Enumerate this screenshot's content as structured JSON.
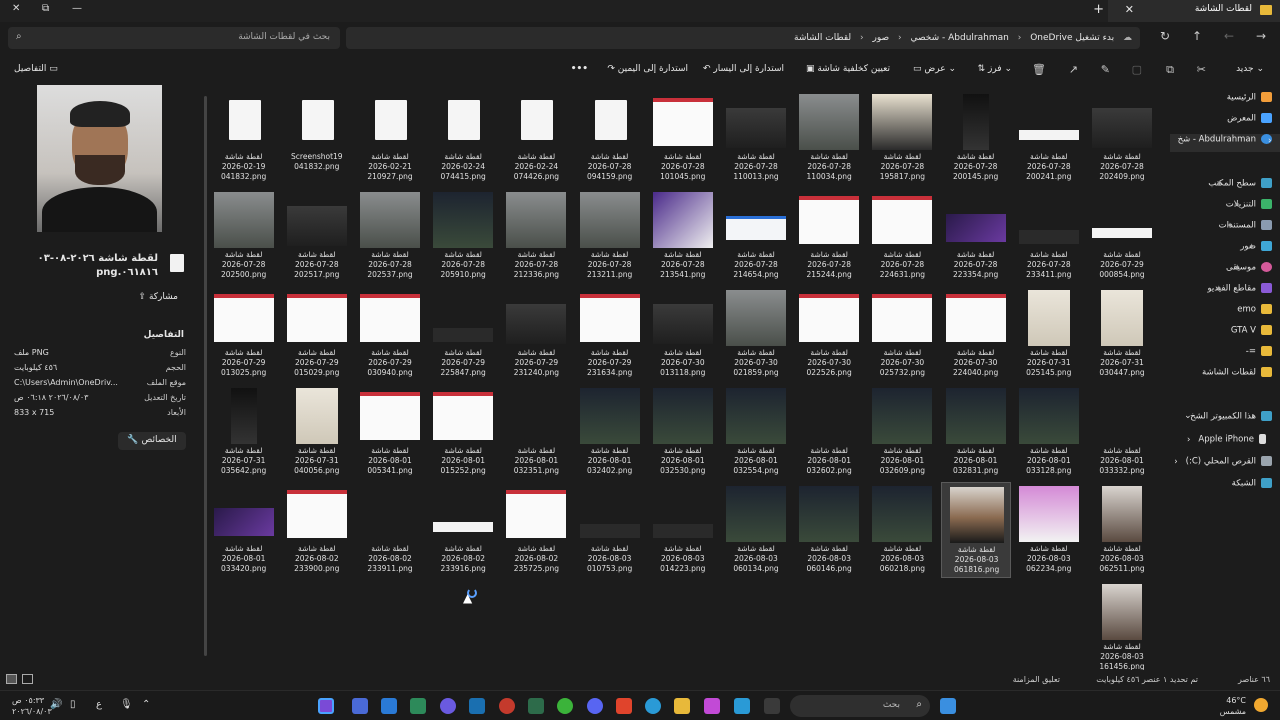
{
  "window": {
    "tab_title": "لقطات الشاشة",
    "controls": {
      "close": "✕",
      "maximize": "⧉",
      "minimize": "—",
      "new_tab": "+"
    }
  },
  "address_bar": {
    "crumbs": [
      "بدء تشغيل OneDrive",
      "Abdulrahman - شخصي",
      "صور",
      "لقطات الشاشة"
    ],
    "search_placeholder": "بحث في لقطات الشاشة"
  },
  "toolbar": {
    "new": "جديد",
    "sort": "فرز",
    "view": "عرض",
    "set_background": "تعيين كخلفية شاشة",
    "rotate_left": "استدارة إلى اليسار",
    "rotate_right": "استدارة إلى اليمين",
    "more": "•••",
    "details": "التفاصيل"
  },
  "details_pane": {
    "file_name": "لقطة شاشة ٢٠٢٦-٠٨-٠٣ ٠٦١٨١٦.png",
    "share": "مشاركة",
    "section_title": "التفاصيل",
    "properties": [
      {
        "key": "النوع",
        "value": "ملف PNG"
      },
      {
        "key": "الحجم",
        "value": "٤٥٦ كيلوبايت"
      },
      {
        "key": "موقع الملف",
        "value": "C:\\Users\\Admin\\OneDriv..."
      },
      {
        "key": "تاريخ التعديل",
        "value": "٢٠٢٦/٠٨/٠٣ ٠٦:١٨ ص"
      },
      {
        "key": "الأبعاد",
        "value": "833 x 715"
      }
    ],
    "properties_button": "الخصائص"
  },
  "files": [
    {
      "date": "2026-07-28",
      "time": "202409.png",
      "thumb": "dark"
    },
    {
      "date": "2026-07-28",
      "time": "200241.png",
      "thumb": "white-strip"
    },
    {
      "date": "2026-07-28",
      "time": "200145.png",
      "thumb": "phone"
    },
    {
      "date": "2026-07-28",
      "time": "195817.png",
      "thumb": "poster"
    },
    {
      "date": "2026-07-28",
      "time": "110034.png",
      "thumb": "game"
    },
    {
      "date": "2026-07-28",
      "time": "110013.png",
      "thumb": "dark"
    },
    {
      "date": "2026-07-28",
      "time": "101045.png",
      "thumb": "doc-red"
    },
    {
      "date": "2026-07-28",
      "time": "094159.png",
      "thumb": "file"
    },
    {
      "date": "2026-02-24",
      "time": "074426.png",
      "thumb": "file"
    },
    {
      "date": "2026-02-24",
      "time": "074415.png",
      "thumb": "file"
    },
    {
      "date": "2026-02-21",
      "time": "210927.png",
      "thumb": "file"
    },
    {
      "date": "Screenshot19",
      "time": "041832.png",
      "thumb": "file"
    },
    {
      "date": "2026-02-19",
      "time": "041832.png",
      "thumb": "file"
    },
    {
      "date": "2026-07-29",
      "time": "000854.png",
      "thumb": "white-strip"
    },
    {
      "date": "2026-07-28",
      "time": "233411.png",
      "thumb": "dark-strip"
    },
    {
      "date": "2026-07-28",
      "time": "223354.png",
      "thumb": "purple"
    },
    {
      "date": "2026-07-28",
      "time": "224631.png",
      "thumb": "doc-red"
    },
    {
      "date": "2026-07-28",
      "time": "215244.png",
      "thumb": "doc-red"
    },
    {
      "date": "2026-07-28",
      "time": "214654.png",
      "thumb": "doc-blue"
    },
    {
      "date": "2026-07-28",
      "time": "213541.png",
      "thumb": "purple-doc"
    },
    {
      "date": "2026-07-28",
      "time": "213211.png",
      "thumb": "game"
    },
    {
      "date": "2026-07-28",
      "time": "212336.png",
      "thumb": "game"
    },
    {
      "date": "2026-07-28",
      "time": "205910.png",
      "thumb": "night"
    },
    {
      "date": "2026-07-28",
      "time": "202537.png",
      "thumb": "game"
    },
    {
      "date": "2026-07-28",
      "time": "202517.png",
      "thumb": "dark"
    },
    {
      "date": "2026-07-28",
      "time": "202500.png",
      "thumb": "game"
    },
    {
      "date": "2026-07-31",
      "time": "030447.png",
      "thumb": "paper"
    },
    {
      "date": "2026-07-31",
      "time": "025145.png",
      "thumb": "paper"
    },
    {
      "date": "2026-07-30",
      "time": "224040.png",
      "thumb": "doc-red"
    },
    {
      "date": "2026-07-30",
      "time": "025732.png",
      "thumb": "doc-red"
    },
    {
      "date": "2026-07-30",
      "time": "022526.png",
      "thumb": "doc-red"
    },
    {
      "date": "2026-07-30",
      "time": "021859.png",
      "thumb": "game"
    },
    {
      "date": "2026-07-30",
      "time": "013118.png",
      "thumb": "dark"
    },
    {
      "date": "2026-07-29",
      "time": "231634.png",
      "thumb": "doc-red"
    },
    {
      "date": "2026-07-29",
      "time": "231240.png",
      "thumb": "dark"
    },
    {
      "date": "2026-07-29",
      "time": "225847.png",
      "thumb": "dark-strip"
    },
    {
      "date": "2026-07-29",
      "time": "030940.png",
      "thumb": "doc-red"
    },
    {
      "date": "2026-07-29",
      "time": "015029.png",
      "thumb": "doc-red"
    },
    {
      "date": "2026-07-29",
      "time": "013025.png",
      "thumb": "doc-red"
    },
    {
      "date": "2026-08-01",
      "time": "033332.png",
      "thumb": "none"
    },
    {
      "date": "2026-08-01",
      "time": "033128.png",
      "thumb": "night"
    },
    {
      "date": "2026-08-01",
      "time": "032831.png",
      "thumb": "night"
    },
    {
      "date": "2026-08-01",
      "time": "032609.png",
      "thumb": "night"
    },
    {
      "date": "2026-08-01",
      "time": "032602.png",
      "thumb": "none"
    },
    {
      "date": "2026-08-01",
      "time": "032554.png",
      "thumb": "night"
    },
    {
      "date": "2026-08-01",
      "time": "032530.png",
      "thumb": "night"
    },
    {
      "date": "2026-08-01",
      "time": "032402.png",
      "thumb": "night"
    },
    {
      "date": "2026-08-01",
      "time": "032351.png",
      "thumb": "none"
    },
    {
      "date": "2026-08-01",
      "time": "015252.png",
      "thumb": "doc-red"
    },
    {
      "date": "2026-08-01",
      "time": "005341.png",
      "thumb": "doc-red"
    },
    {
      "date": "2026-07-31",
      "time": "040056.png",
      "thumb": "paper"
    },
    {
      "date": "2026-07-31",
      "time": "035642.png",
      "thumb": "phone"
    },
    {
      "date": "2026-08-03",
      "time": "062511.png",
      "thumb": "person"
    },
    {
      "date": "2026-08-03",
      "time": "062234.png",
      "thumb": "person-white"
    },
    {
      "date": "2026-08-03",
      "time": "061816.png",
      "thumb": "person-selected"
    },
    {
      "date": "2026-08-03",
      "time": "060218.png",
      "thumb": "night"
    },
    {
      "date": "2026-08-03",
      "time": "060146.png",
      "thumb": "night"
    },
    {
      "date": "2026-08-03",
      "time": "060134.png",
      "thumb": "night"
    },
    {
      "date": "2026-08-03",
      "time": "014223.png",
      "thumb": "dark-strip"
    },
    {
      "date": "2026-08-03",
      "time": "010753.png",
      "thumb": "dark-strip"
    },
    {
      "date": "2026-08-02",
      "time": "235725.png",
      "thumb": "doc-red"
    },
    {
      "date": "2026-08-02",
      "time": "233916.png",
      "thumb": "white-strip"
    },
    {
      "date": "2026-08-02",
      "time": "233911.png",
      "thumb": "none"
    },
    {
      "date": "2026-08-02",
      "time": "233900.png",
      "thumb": "doc-red"
    },
    {
      "date": "2026-08-01",
      "time": "033420.png",
      "thumb": "purple"
    },
    {
      "date": "2026-08-03",
      "time": "161456.png",
      "thumb": "person"
    }
  ],
  "file_prefix": "لقطة شاشة",
  "nav": {
    "home": "الرئيسية",
    "gallery": "المعرض",
    "onedrive": "Abdulrahman - شخ",
    "desktop": "سطح المكتب",
    "downloads": "التنزيلات",
    "documents": "المستندات",
    "pictures": "صور",
    "music": "موسيقى",
    "videos": "مقاطع الفيديو",
    "emo": "emo",
    "gta": "GTA V",
    "dash": "=-",
    "screenshots": "لقطات الشاشة",
    "this_pc": "هذا الكمبيوتر الشخ",
    "iphone": "Apple iPhone",
    "local_disk": "القرص المحلي (C:)",
    "network": "الشبكة"
  },
  "status": {
    "items": "٦٦ عناصر",
    "selected": "تم تحديد ١ عنصر  ٤٥٦ كيلوبايت",
    "sync": "تعليق المزامنة"
  },
  "taskbar": {
    "search_placeholder": "بحث",
    "weather_temp": "46°C",
    "weather_desc": "مشمس",
    "time": "٠٥:٣٣ ص",
    "date": "٢٠٢٦/٠٨/٠٣",
    "lang": "ع"
  },
  "colors": {
    "accent": "#4aa3ff",
    "folder": "#e8b93a",
    "selection": "#3a3a3a"
  }
}
